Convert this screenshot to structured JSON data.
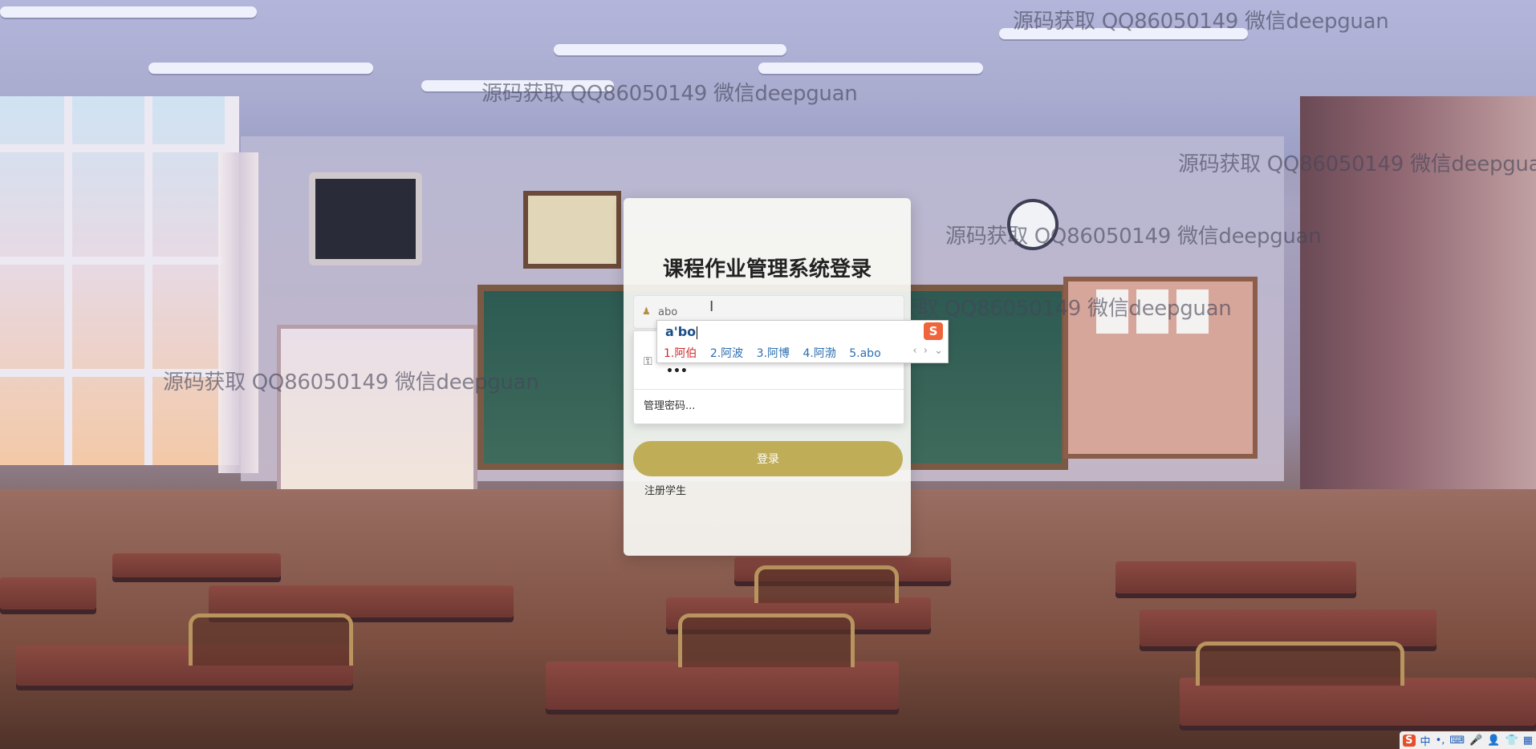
{
  "page": {
    "title": "课程作业管理系统登录"
  },
  "login": {
    "username_value": "abo",
    "password_mask": "•••",
    "manage_passwords": "管理密码...",
    "login_button": "登录",
    "register_link": "注册学生"
  },
  "ime": {
    "composition": "a'bo",
    "logo": "S",
    "candidates": [
      "1.阿伯",
      "2.阿波",
      "3.阿博",
      "4.阿渤",
      "5.abo"
    ],
    "nav_prev": "‹",
    "nav_next": "›",
    "nav_expand": "⌄"
  },
  "watermark_text": "源码获取 QQ86050149 微信deepguan",
  "tray": {
    "ime_logo": "S",
    "items": [
      "中",
      "•,",
      "⌨",
      "🎤",
      "👤",
      "👕",
      "▦"
    ]
  }
}
